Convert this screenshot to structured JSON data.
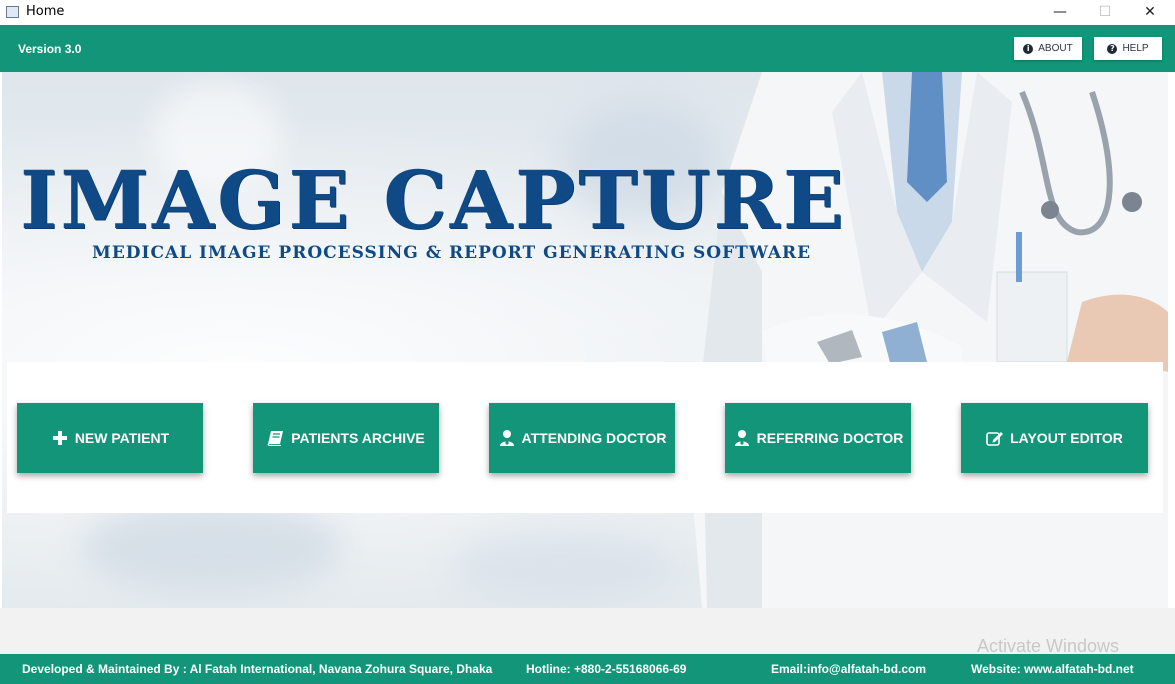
{
  "window": {
    "title": "Home",
    "minimize": "—",
    "maximize": "☐",
    "close": "✕"
  },
  "header": {
    "version": "Version 3.0",
    "about_label": "ABOUT",
    "help_label": "HELP"
  },
  "brand": {
    "title": "IMAGE CAPTURE",
    "subtitle": "MEDICAL IMAGE PROCESSING & REPORT GENERATING SOFTWARE"
  },
  "nav": {
    "new_patient": "NEW PATIENT",
    "patients_archive": "PATIENTS ARCHIVE",
    "attending_doctor": "ATTENDING DOCTOR",
    "referring_doctor": "REFERRING DOCTOR",
    "layout_editor": "LAYOUT EDITOR"
  },
  "footer": {
    "developer": "Developed & Maintained By : Al Fatah International, Navana Zohura Square, Dhaka",
    "hotline": "Hotline: +880-2-55168066-69",
    "email": "Email:info@alfatah-bd.com",
    "website": "Website: www.alfatah-bd.net"
  },
  "watermark": "Activate Windows",
  "colors": {
    "accent": "#129579",
    "brand_blue": "#0f4a86"
  },
  "icons": [
    "app-icon",
    "info-icon",
    "question-icon",
    "plus-icon",
    "book-icon",
    "doctor-icon",
    "edit-icon"
  ]
}
